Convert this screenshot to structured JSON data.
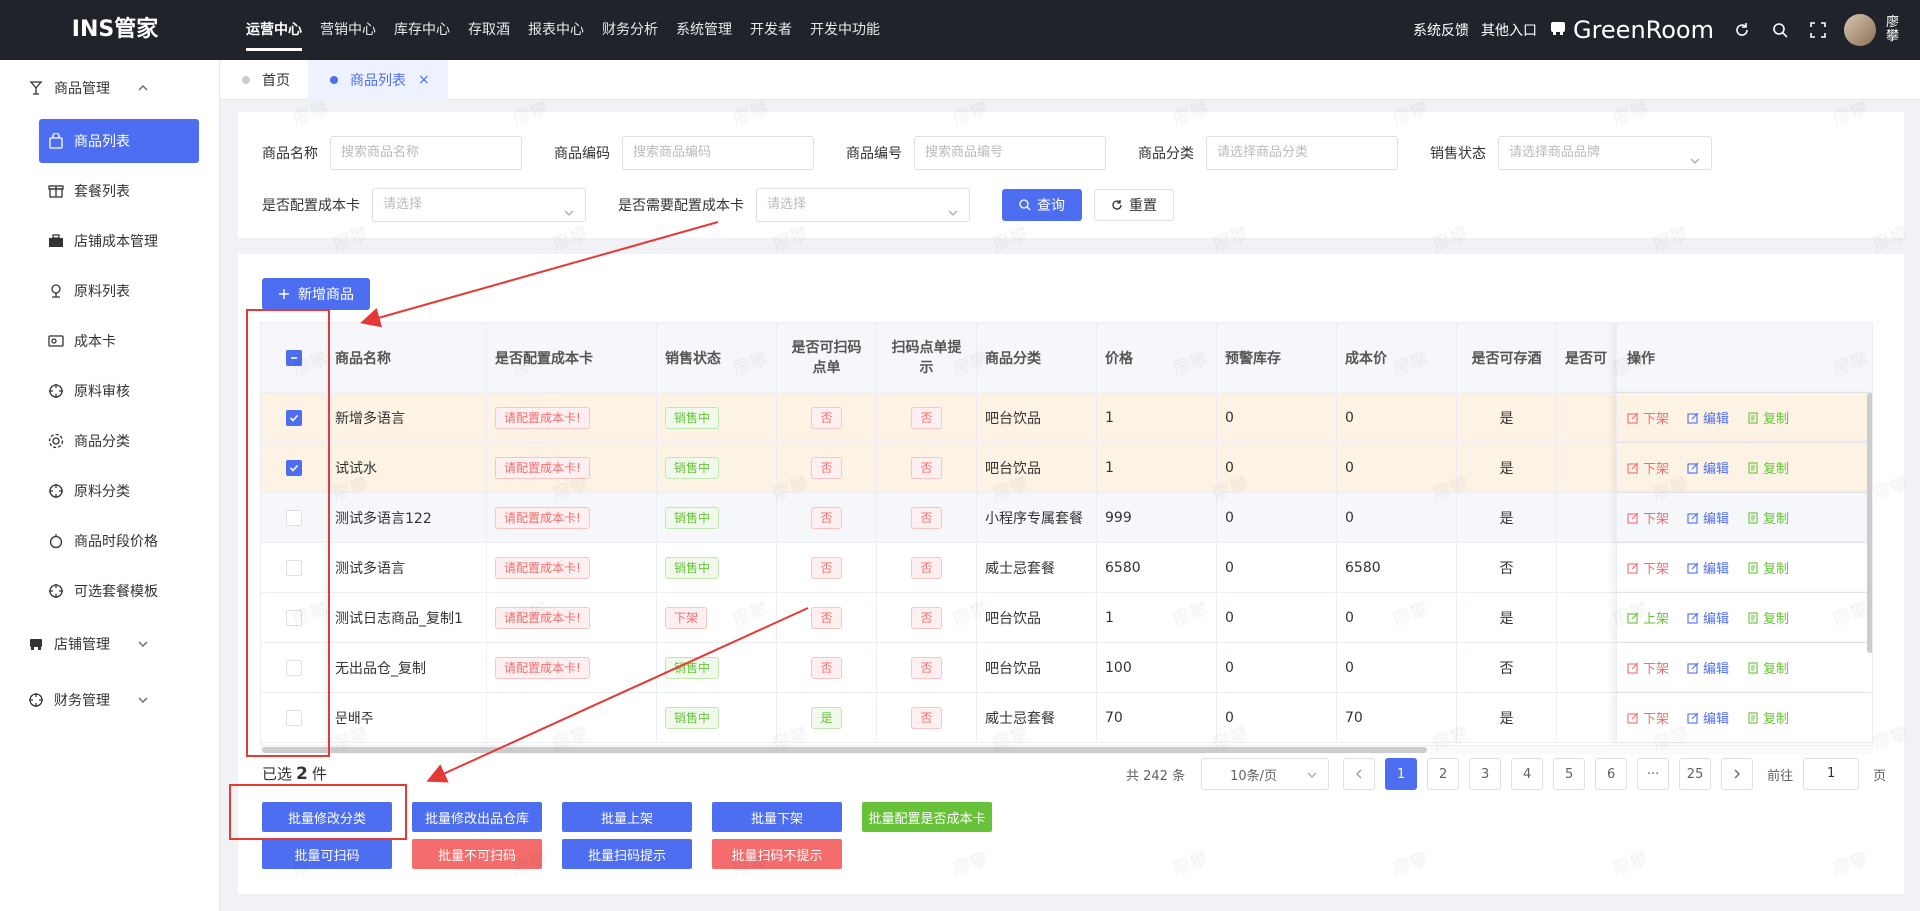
{
  "app": {
    "logo": "INS管家"
  },
  "nav": [
    "运营中心",
    "营销中心",
    "库存中心",
    "存取酒",
    "报表中心",
    "财务分析",
    "系统管理",
    "开发者",
    "开发中功能"
  ],
  "top_right": {
    "feedback": "系统反馈",
    "other": "其他入口",
    "store": "GreenRoom",
    "user": "廖攀"
  },
  "sidebar": {
    "group1": "商品管理",
    "items": [
      "商品列表",
      "套餐列表",
      "店铺成本管理",
      "原料列表",
      "成本卡",
      "原料审核",
      "商品分类",
      "原料分类",
      "商品时段价格",
      "可选套餐模板"
    ],
    "group2": "店铺管理",
    "group3": "财务管理"
  },
  "tabs": [
    {
      "label": "首页"
    },
    {
      "label": "商品列表"
    }
  ],
  "filters": {
    "name_label": "商品名称",
    "name_ph": "搜索商品名称",
    "code_label": "商品编码",
    "code_ph": "搜索商品编码",
    "no_label": "商品编号",
    "no_ph": "搜索商品编号",
    "cat_label": "商品分类",
    "cat_ph": "请选择商品分类",
    "status_label": "销售状态",
    "status_ph": "请选择商品品牌",
    "cost_label": "是否配置成本卡",
    "cost_ph": "请选择",
    "need_label": "是否需要配置成本卡",
    "need_ph": "请选择",
    "query": "查询",
    "reset": "重置"
  },
  "add_button": "新增商品",
  "table": {
    "headers": [
      "商品名称",
      "是否配置成本卡",
      "销售状态",
      "是否可扫码点单",
      "扫码点单提示",
      "商品分类",
      "价格",
      "预警库存",
      "成本价",
      "是否可存酒",
      "是否可",
      "操作"
    ],
    "rows": [
      {
        "name": "新增多语言",
        "cost": "请配置成本卡!",
        "status": "销售中",
        "scan": "否",
        "tip": "否",
        "cat": "吧台饮品",
        "price": "1",
        "warn": "0",
        "costp": "0",
        "store": "是",
        "up": "下架",
        "edit": "编辑",
        "copy": "复制"
      },
      {
        "name": "试试水",
        "cost": "请配置成本卡!",
        "status": "销售中",
        "scan": "否",
        "tip": "否",
        "cat": "吧台饮品",
        "price": "1",
        "warn": "0",
        "costp": "0",
        "store": "是",
        "up": "下架",
        "edit": "编辑",
        "copy": "复制"
      },
      {
        "name": "测试多语言122",
        "cost": "请配置成本卡!",
        "status": "销售中",
        "scan": "否",
        "tip": "否",
        "cat": "小程序专属套餐",
        "price": "999",
        "warn": "0",
        "costp": "0",
        "store": "是",
        "up": "下架",
        "edit": "编辑",
        "copy": "复制"
      },
      {
        "name": "测试多语言",
        "cost": "请配置成本卡!",
        "status": "销售中",
        "scan": "否",
        "tip": "否",
        "cat": "威士忌套餐",
        "price": "6580",
        "warn": "0",
        "costp": "6580",
        "store": "否",
        "up": "下架",
        "edit": "编辑",
        "copy": "复制"
      },
      {
        "name": "测试日志商品_复制1",
        "cost": "请配置成本卡!",
        "status": "下架",
        "scan": "否",
        "tip": "否",
        "cat": "吧台饮品",
        "price": "1",
        "warn": "0",
        "costp": "0",
        "store": "是",
        "up": "上架",
        "edit": "编辑",
        "copy": "复制"
      },
      {
        "name": "无出品仓_复制",
        "cost": "请配置成本卡!",
        "status": "销售中",
        "scan": "否",
        "tip": "否",
        "cat": "吧台饮品",
        "price": "100",
        "warn": "0",
        "costp": "0",
        "store": "否",
        "up": "下架",
        "edit": "编辑",
        "copy": "复制"
      },
      {
        "name": "문배주",
        "cost": "",
        "status": "销售中",
        "scan": "是",
        "tip": "否",
        "cat": "威士忌套餐",
        "price": "70",
        "warn": "0",
        "costp": "70",
        "store": "是",
        "up": "下架",
        "edit": "编辑",
        "copy": "复制"
      }
    ]
  },
  "selection": {
    "prefix": "已选",
    "count": "2",
    "suffix": "件"
  },
  "pager": {
    "total": "共 242 条",
    "size": "10条/页",
    "pages": [
      "1",
      "2",
      "3",
      "4",
      "5",
      "6",
      "···",
      "25"
    ],
    "goto": "前往",
    "goto_val": "1",
    "page_unit": "页"
  },
  "batch": [
    "批量修改分类",
    "批量修改出品仓库",
    "批量上架",
    "批量下架",
    "批量配置是否成本卡",
    "批量可扫码",
    "批量不可扫码",
    "批量扫码提示",
    "批量扫码不提示"
  ],
  "watermark": "廖攀",
  "colors": {
    "primary": "#4e6ef2",
    "danger": "#f56c6c",
    "success": "#67c23a",
    "annotation": "#e53935"
  }
}
